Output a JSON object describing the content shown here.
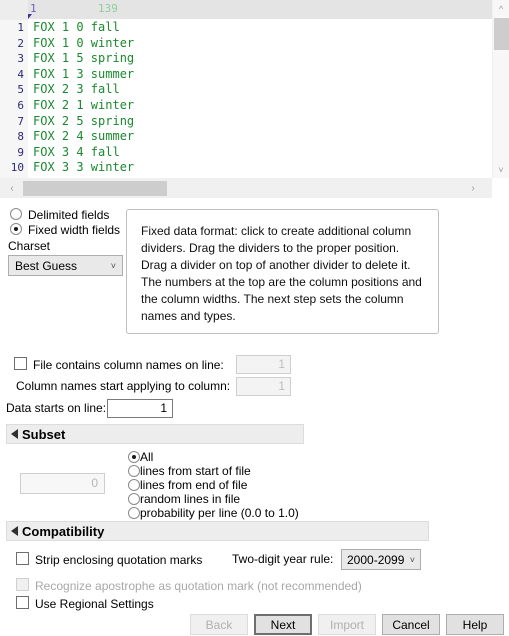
{
  "preview": {
    "ruler": {
      "column_position": "1",
      "column_width": "139"
    },
    "lines": [
      {
        "n": "1",
        "text": "FOX 1 0 fall"
      },
      {
        "n": "2",
        "text": "FOX 1 0 winter"
      },
      {
        "n": "3",
        "text": "FOX 1 5 spring"
      },
      {
        "n": "4",
        "text": "FOX 1 3 summer"
      },
      {
        "n": "5",
        "text": "FOX 2 3 fall"
      },
      {
        "n": "6",
        "text": "FOX 2 1 winter"
      },
      {
        "n": "7",
        "text": "FOX 2 5 spring"
      },
      {
        "n": "8",
        "text": "FOX 2 4 summer"
      },
      {
        "n": "9",
        "text": "FOX 3 4 fall"
      },
      {
        "n": "10",
        "text": "FOX 3 3 winter"
      }
    ],
    "scroll_up_icon": "chevron-up-icon",
    "scroll_down_icon": "chevron-down-icon",
    "scroll_left_icon": "chevron-left-icon",
    "scroll_right_icon": "chevron-right-icon"
  },
  "format": {
    "delimited_label": "Delimited fields",
    "fixed_label": "Fixed width fields",
    "selected": "fixed"
  },
  "charset": {
    "label": "Charset",
    "value": "Best Guess",
    "chevron": "˅",
    "options": [
      "Best Guess"
    ]
  },
  "hint": {
    "text": "Fixed data format: click to create additional column dividers. Drag the dividers to the proper position. Drag a divider on top of another divider to delete it. The numbers at the top are the column positions and the column widths. The next step sets the column names and types."
  },
  "column_names": {
    "contains_label": "File contains column names on line:",
    "contains_checked": false,
    "contains_line_value": "1",
    "applying_label": "Column names start applying to column:",
    "applying_value": "1",
    "data_starts_label": "Data starts on line:",
    "data_starts_value": "1"
  },
  "subset": {
    "title": "Subset",
    "value": "0",
    "options": [
      "All",
      "lines from start of file",
      "lines from end of file",
      "random lines in file",
      "probability per line (0.0 to 1.0)"
    ],
    "selected_index": 0
  },
  "compatibility": {
    "title": "Compatibility",
    "strip_quotes_label": "Strip enclosing quotation marks",
    "strip_quotes_checked": false,
    "apostrophe_label": "Recognize apostrophe as quotation mark (not recommended)",
    "apostrophe_checked": false,
    "regional_label": "Use Regional Settings",
    "regional_checked": false,
    "year_rule_label": "Two-digit year rule:",
    "year_rule_value": "2000-2099",
    "year_rule_chevron": "˅"
  },
  "buttons": {
    "back": "Back",
    "next": "Next",
    "import": "Import",
    "cancel": "Cancel",
    "help": "Help"
  },
  "colors": {
    "code_text": "#1a8a2e",
    "line_number": "#2a2a7a",
    "ruler_position": "#6b60c9",
    "ruler_width": "#8fcf9b",
    "panel_bg": "#ededed"
  }
}
